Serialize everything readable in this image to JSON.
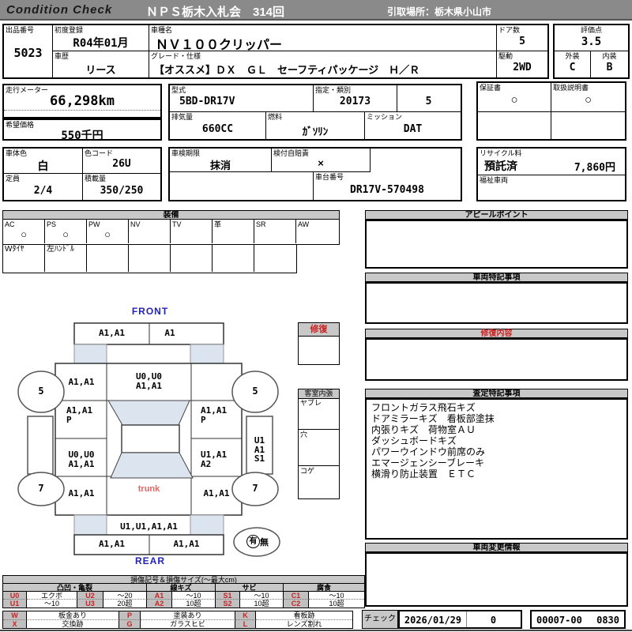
{
  "header": {
    "logo": "Condition  Check",
    "title": "ＮＰＳ栃木入札会　314回",
    "pickup": "引取場所：栃木県小山市"
  },
  "colors": {
    "header_bg": "#8a8a8a",
    "panel_header_bg": "#c8c8c8",
    "code_bg": "#c0c0c0",
    "red_accent": "#cc2222",
    "blue_label": "#2222bb",
    "glass_fill": "#dbe4ef",
    "trunk_red": "#e06666"
  },
  "info": {
    "lot_label": "出品番号",
    "lot_no": "5023",
    "first_reg_label": "初度登録",
    "first_reg": "R04年01月",
    "model_name_label": "車種名",
    "model_name": "ＮＶ１００クリッパー",
    "doors_label": "ドア数",
    "doors": "5",
    "score_label": "評価点",
    "score": "3.5",
    "history_label": "車歴",
    "history": "リース",
    "grade_label": "グレード・仕様",
    "grade": "【オススメ】ＤＸ　ＧＬ　セーフティパッケージ　Ｈ／Ｒ",
    "drive_label": "駆動",
    "drive": "2WD",
    "exterior_label": "外装",
    "exterior": "C",
    "interior_label": "内装",
    "interior": "B",
    "odo_label": "走行メーター",
    "odo": "66,298km",
    "price_label": "希望価格",
    "price": "550千円",
    "model_code_label": "型式",
    "model_code": "5BD-DR17V",
    "class_label": "指定・類別",
    "class1": "20173",
    "class2": "5",
    "warranty_label": "保証書",
    "warranty": "○",
    "manual_label": "取扱説明書",
    "manual": "○",
    "displacement_label": "排気量",
    "displacement": "660CC",
    "fuel_label": "燃料",
    "fuel": "ｶﾞｿﾘﾝ",
    "mission_label": "ミッション",
    "mission": "DAT",
    "body_color_label": "車体色",
    "body_color": "白",
    "color_code_label": "色コード",
    "color_code": "26U",
    "inspection_label": "車検期限",
    "inspection": "抹消",
    "insurance_label": "検付自賠責",
    "insurance": "×",
    "recycle_label": "リサイクル料",
    "recycle_status": "預託済",
    "recycle_fee": "7,860円",
    "capacity_label": "定員",
    "capacity": "2/4",
    "load_label": "積載量",
    "load": "350/250",
    "vin_label": "車台番号",
    "vin": "DR17V-570498",
    "welfare_label": "福祉車両"
  },
  "equipment": {
    "title": "装備",
    "items": [
      {
        "label": "AC",
        "value": "○"
      },
      {
        "label": "PS",
        "value": "○"
      },
      {
        "label": "PW",
        "value": "○"
      },
      {
        "label": "NV",
        "value": ""
      },
      {
        "label": "TV",
        "value": ""
      },
      {
        "label": "革",
        "value": ""
      },
      {
        "label": "SR",
        "value": ""
      },
      {
        "label": "AW",
        "value": ""
      }
    ],
    "extra": [
      "Wﾀｲﾔ",
      "左ﾊﾝﾄﾞﾙ",
      "",
      "",
      "",
      "",
      ""
    ]
  },
  "panels": {
    "appeal_title": "アピールポイント",
    "notes_title": "車両特記事項",
    "repair_title": "修復内容",
    "assessment_title": "査定特記事項",
    "assessment_lines": [
      "フロントガラス飛石キズ",
      "ドアミラーキズ　看板部塗抹",
      "内張りキズ　荷物室ＡＵ",
      "ダッシュボードキズ",
      "パワーウインドウ前席のみ",
      "エマージェンシーブレーキ",
      "横滑り防止装置　ＥＴＣ"
    ],
    "change_title": "車両変更情報",
    "check_label": "チェック",
    "check_date": "2026/01/29",
    "check_value": "0",
    "check_code": "00007-00",
    "check_time": "0830"
  },
  "diagram": {
    "front_label": "FRONT",
    "rear_label": "REAR",
    "trunk_label": "trunk",
    "repair_box_title": "修復",
    "cabin_box_title": "客室内張",
    "cabin_items": [
      "ヤブレ",
      "穴",
      "コゲ"
    ],
    "wheel_front": "5",
    "wheel_rear": "7",
    "spare_yes": "有",
    "spare_no": "無",
    "marks": {
      "front_bumper_left": "A1,A1",
      "front_bumper_right": "A1",
      "left_fender": "A1,A1",
      "hood_line1": "U0,U0",
      "hood_line2": "A1,A1",
      "left_door_line1": "A1,A1",
      "left_door_line2": "P",
      "right_door_line1": "A1,A1",
      "right_door_line2": "P",
      "left_quarter_line1": "U0,U0",
      "left_quarter_line2": "A1,A1",
      "right_quarter_line1": "U1,A1",
      "right_quarter_line2": "A2",
      "right_side_line1": "U1",
      "right_side_line2": "A1",
      "right_side_line3": "S1",
      "rear_left": "A1,A1",
      "rear_right": "A1,A1",
      "rear_gate": "U1,U1,A1,A1",
      "rear_bumper_left": "A1,A1",
      "rear_bumper_right": "A1,A1"
    }
  },
  "legend": {
    "title": "損傷記号＆損傷サイズ(～最大cm)",
    "groups": [
      "凸凹・亀裂",
      "線キズ",
      "サビ",
      "腐食"
    ],
    "rows": [
      [
        {
          "c": "U0",
          "v": "エクボ"
        },
        {
          "c": "U2",
          "v": "～20"
        },
        {
          "c": "A1",
          "v": "～10"
        },
        {
          "c": "S1",
          "v": "～10"
        },
        {
          "c": "C1",
          "v": "～10"
        }
      ],
      [
        {
          "c": "U1",
          "v": "～10"
        },
        {
          "c": "U3",
          "v": "20超"
        },
        {
          "c": "A2",
          "v": "10超"
        },
        {
          "c": "S2",
          "v": "10超"
        },
        {
          "c": "C2",
          "v": "10超"
        }
      ]
    ],
    "codes2": [
      [
        {
          "c": "W",
          "v": "板金あり"
        },
        {
          "c": "P",
          "v": "塗装あり"
        },
        {
          "c": "K",
          "v": "看板跡"
        }
      ],
      [
        {
          "c": "X",
          "v": "交換跡"
        },
        {
          "c": "G",
          "v": "ガラスヒビ"
        },
        {
          "c": "L",
          "v": "レンズ割れ"
        }
      ]
    ]
  }
}
